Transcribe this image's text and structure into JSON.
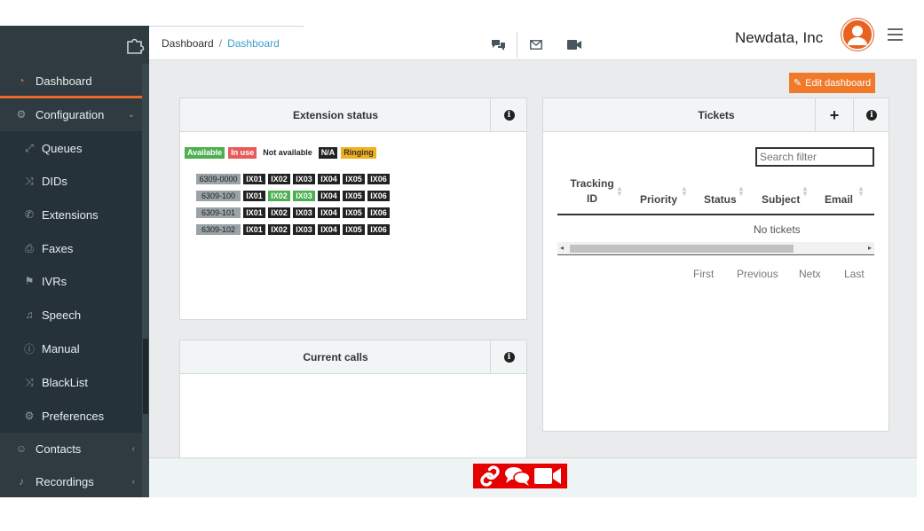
{
  "sidebar": {
    "items": [
      {
        "label": "Dashboard",
        "icon": "speedometer-icon"
      },
      {
        "label": "Configuration",
        "icon": "gear-icon"
      },
      {
        "label": "Queues",
        "icon": "arrows-expand-icon"
      },
      {
        "label": "DIDs",
        "icon": "shuffle-icon"
      },
      {
        "label": "Extensions",
        "icon": "phone-icon"
      },
      {
        "label": "Faxes",
        "icon": "printer-icon"
      },
      {
        "label": "IVRs",
        "icon": "signpost-icon"
      },
      {
        "label": "Speech",
        "icon": "music-note-icon"
      },
      {
        "label": "Manual",
        "icon": "info-circle-icon"
      },
      {
        "label": "BlackList",
        "icon": "shuffle-icon"
      },
      {
        "label": "Preferences",
        "icon": "gear-icon"
      },
      {
        "label": "Contacts",
        "icon": "user-icon"
      },
      {
        "label": "Recordings",
        "icon": "headphones-icon"
      }
    ]
  },
  "header": {
    "breadcrumb": {
      "root": "Dashboard",
      "sep": "/",
      "current": "Dashboard"
    },
    "company": "Newdata, Inc"
  },
  "main": {
    "edit_label": "Edit dashboard",
    "extension_status": {
      "title": "Extension status",
      "legend": {
        "available": "Available",
        "in_use": "In use",
        "not_available": "Not available",
        "na": "N/A",
        "ringing": "Ringing"
      },
      "rows": [
        {
          "ext": "6309-0000",
          "channels": [
            "IX01",
            "IX02",
            "IX03",
            "IX04",
            "IX05",
            "IX06"
          ]
        },
        {
          "ext": "6309-100",
          "channels": [
            "IX01",
            "IX02",
            "IX03",
            "IX04",
            "IX05",
            "IX06"
          ]
        },
        {
          "ext": "6309-101",
          "channels": [
            "IX01",
            "IX02",
            "IX03",
            "IX04",
            "IX05",
            "IX06"
          ]
        },
        {
          "ext": "6309-102",
          "channels": [
            "IX01",
            "IX02",
            "IX03",
            "IX04",
            "IX05",
            "IX06"
          ]
        }
      ]
    },
    "current_calls": {
      "title": "Current calls"
    },
    "tickets": {
      "title": "Tickets",
      "search_placeholder": "Search filter",
      "columns": {
        "tracking_1": "Tracking",
        "tracking_2": "ID",
        "priority": "Priority",
        "status": "Status",
        "subject": "Subject",
        "email": "Email"
      },
      "empty": "No tickets",
      "pager": {
        "first": "First",
        "previous": "Previous",
        "next": "Netx",
        "last": "Last"
      }
    }
  },
  "colors": {
    "accent": "#f07a2a",
    "sidebar": "#2f3b40",
    "available": "#4caf50",
    "in_use": "#e85b5b",
    "ringing": "#f2b01e",
    "call_bar": "#e60000"
  }
}
